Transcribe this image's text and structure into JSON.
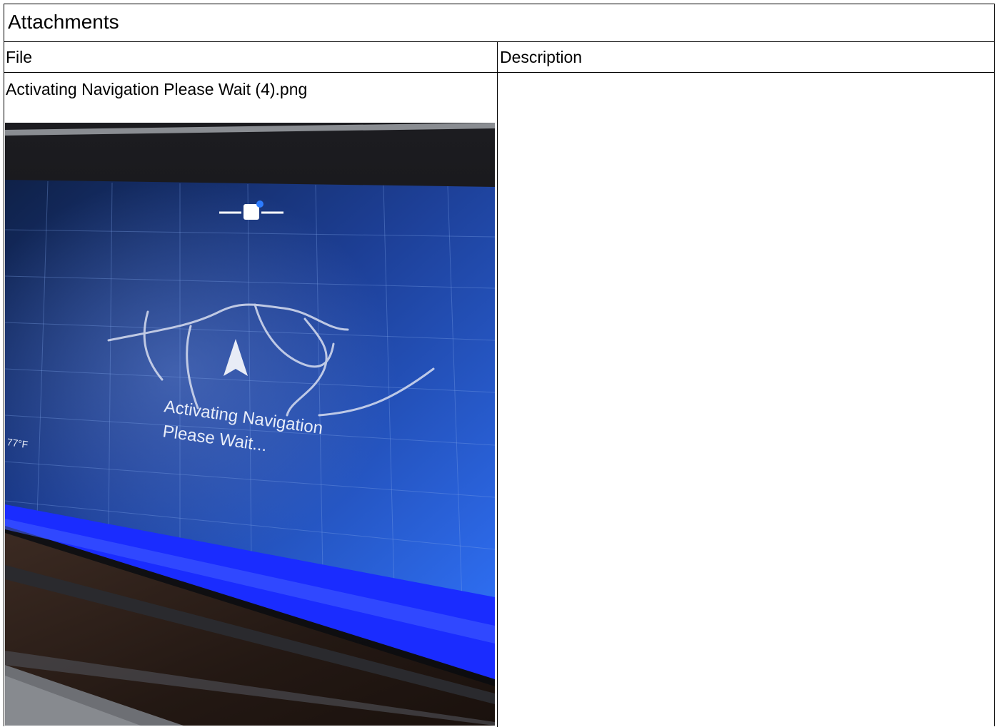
{
  "panel": {
    "title": "Attachments"
  },
  "table": {
    "columns": [
      "File",
      "Description"
    ],
    "rows": [
      {
        "file_name": "Activating Navigation Please Wait (4).png",
        "description": ""
      }
    ]
  },
  "attachment_image": {
    "screen_text_line1": "Activating Navigation",
    "screen_text_line2": "Please Wait...",
    "temperature": "77°F"
  },
  "colors": {
    "screen_blue": "#1f4fd0",
    "ambient_light": "#1a2cff",
    "border": "#000000"
  }
}
